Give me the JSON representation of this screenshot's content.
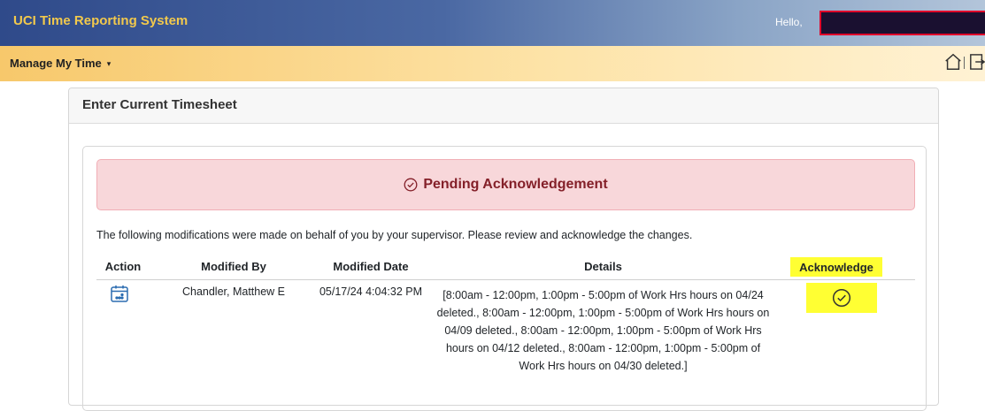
{
  "app": {
    "title": "UCI Time Reporting System",
    "greeting": "Hello,"
  },
  "nav": {
    "menu_label": "Manage My Time"
  },
  "page": {
    "card_title": "Enter Current Timesheet",
    "alert_text": "Pending Acknowledgement",
    "note": "The following modifications were made on behalf of you by your supervisor. Please review and acknowledge the changes."
  },
  "table": {
    "headers": {
      "action": "Action",
      "modified_by": "Modified By",
      "modified_date": "Modified Date",
      "details": "Details",
      "acknowledge": "Acknowledge"
    },
    "rows": [
      {
        "modified_by": "Chandler, Matthew E",
        "modified_date": "05/17/24 4:04:32 PM",
        "details": "[8:00am - 12:00pm, 1:00pm - 5:00pm of Work Hrs hours on 04/24 deleted., 8:00am - 12:00pm, 1:00pm - 5:00pm of Work Hrs hours on 04/09 deleted., 8:00am - 12:00pm, 1:00pm - 5:00pm of Work Hrs hours on 04/12 deleted., 8:00am - 12:00pm, 1:00pm - 5:00pm of Work Hrs hours on 04/30 deleted.]"
      }
    ]
  },
  "colors": {
    "header_blue": "#2f4a8a",
    "title_gold": "#f2c94c",
    "nav_orange": "#f7c86b",
    "alert_bg": "#f8d7da",
    "alert_text": "#842029",
    "highlight": "#ffff33",
    "icon_blue": "#2b6cb0"
  },
  "icons": {
    "home": "home-icon",
    "logout": "logout-icon",
    "alert": "check-circle-icon",
    "action": "calendar-icon",
    "acknowledge": "check-circle-icon"
  }
}
